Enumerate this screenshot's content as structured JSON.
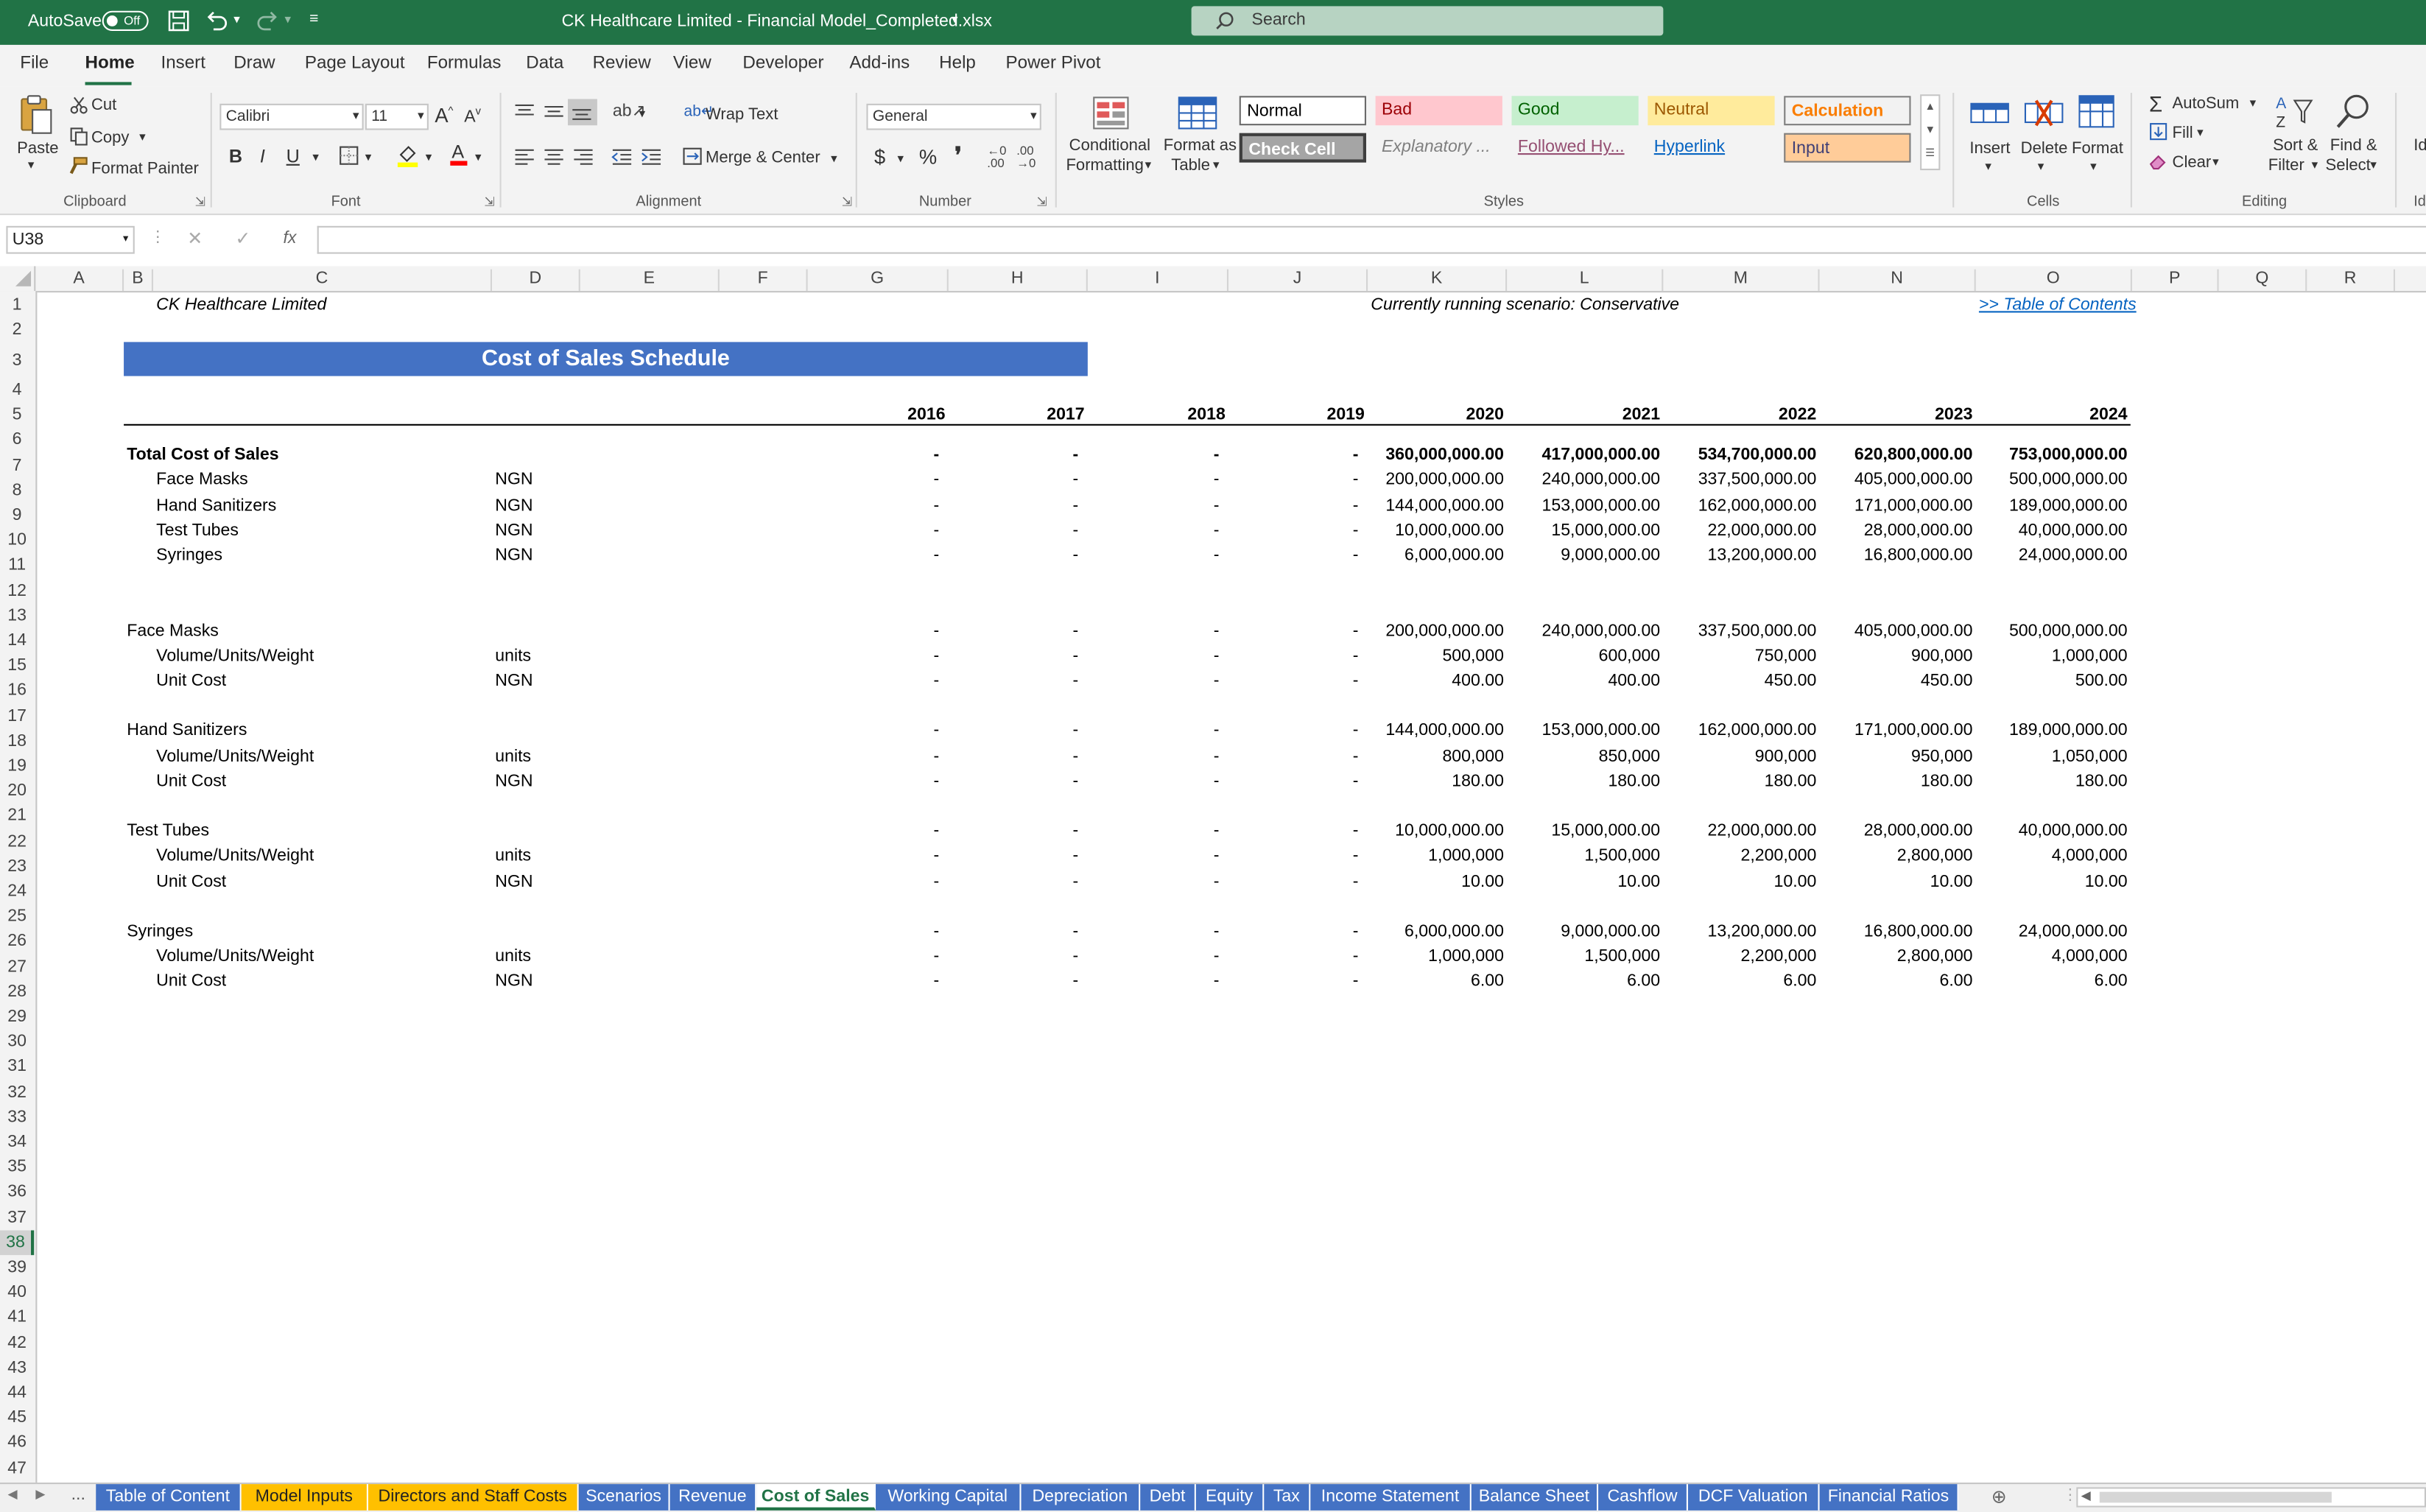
{
  "titlebar": {
    "autosave_label": "AutoSave",
    "autosave_state": "Off",
    "filename": "CK Healthcare Limited - Financial Model_Completed.xlsx",
    "search_placeholder": "Search"
  },
  "menu": [
    "File",
    "Home",
    "Insert",
    "Draw",
    "Page Layout",
    "Formulas",
    "Data",
    "Review",
    "View",
    "Developer",
    "Add-ins",
    "Help",
    "Power Pivot"
  ],
  "ribbon": {
    "clipboard": {
      "paste": "Paste",
      "cut": "Cut",
      "copy": "Copy",
      "format_painter": "Format Painter",
      "group": "Clipboard"
    },
    "font": {
      "name": "Calibri",
      "size": "11",
      "group": "Font",
      "bold": "B",
      "italic": "I",
      "underline": "U"
    },
    "alignment": {
      "wrap_text": "Wrap Text",
      "merge_center": "Merge & Center",
      "group": "Alignment"
    },
    "number": {
      "format": "General",
      "currency": "$",
      "percent": "%",
      "comma": "ஞ",
      "group": "Number"
    },
    "styles": {
      "conditional": "Conditional",
      "formatting": "Formatting",
      "format_as": "Format as",
      "table": "Table",
      "group": "Styles",
      "cells": [
        {
          "label": "Normal"
        },
        {
          "label": "Bad"
        },
        {
          "label": "Good"
        },
        {
          "label": "Neutral"
        },
        {
          "label": "Calculation"
        },
        {
          "label": "Check Cell"
        },
        {
          "label": "Explanatory ..."
        },
        {
          "label": "Followed Hy..."
        },
        {
          "label": "Hyperlink"
        },
        {
          "label": "Input"
        }
      ]
    },
    "cells": {
      "insert": "Insert",
      "delete": "Delete",
      "format": "Format",
      "group": "Cells"
    },
    "editing": {
      "autosum": "AutoSum",
      "fill": "Fill",
      "clear": "Clear",
      "sort": "Sort &",
      "filter": "Filter",
      "find": "Find &",
      "select": "Select",
      "group": "Editing",
      "extra": "Id"
    }
  },
  "formula": {
    "name_box": "U38",
    "fx": "fx",
    "content": ""
  },
  "columns": [
    "A",
    "B",
    "C",
    "D",
    "E",
    "F",
    "G",
    "H",
    "I",
    "J",
    "K",
    "L",
    "M",
    "N",
    "O",
    "P",
    "Q",
    "R"
  ],
  "rows": [
    "1",
    "2",
    "3",
    "4",
    "5",
    "6",
    "7",
    "8",
    "9",
    "10",
    "11",
    "12",
    "13",
    "14",
    "15",
    "16",
    "17",
    "18",
    "19",
    "20",
    "21",
    "22",
    "23",
    "24",
    "25",
    "26",
    "27",
    "28",
    "29",
    "30",
    "31",
    "32",
    "33",
    "34",
    "35",
    "36",
    "37",
    "38",
    "39",
    "40",
    "41",
    "42",
    "43",
    "44",
    "45",
    "46",
    "47"
  ],
  "sheet": {
    "company": "CK Healthcare Limited",
    "scenario": "Currently running scenario: Conservative",
    "toc_link": ">> Table of Contents",
    "title": "Cost of Sales Schedule",
    "years": [
      "2016",
      "2017",
      "2018",
      "2019",
      "2020",
      "2021",
      "2022",
      "2023",
      "2024"
    ],
    "table": [
      {
        "row": 7,
        "label": "Total Cost of Sales",
        "unit": "",
        "bold": true,
        "indent": false,
        "values": [
          "-",
          "-",
          "-",
          "-",
          "360,000,000.00",
          "417,000,000.00",
          "534,700,000.00",
          "620,800,000.00",
          "753,000,000.00"
        ]
      },
      {
        "row": 8,
        "label": "Face Masks",
        "unit": "NGN",
        "bold": false,
        "indent": true,
        "values": [
          "-",
          "-",
          "-",
          "-",
          "200,000,000.00",
          "240,000,000.00",
          "337,500,000.00",
          "405,000,000.00",
          "500,000,000.00"
        ]
      },
      {
        "row": 9,
        "label": "Hand Sanitizers",
        "unit": "NGN",
        "bold": false,
        "indent": true,
        "values": [
          "-",
          "-",
          "-",
          "-",
          "144,000,000.00",
          "153,000,000.00",
          "162,000,000.00",
          "171,000,000.00",
          "189,000,000.00"
        ]
      },
      {
        "row": 10,
        "label": "Test Tubes",
        "unit": "NGN",
        "bold": false,
        "indent": true,
        "values": [
          "-",
          "-",
          "-",
          "-",
          "10,000,000.00",
          "15,000,000.00",
          "22,000,000.00",
          "28,000,000.00",
          "40,000,000.00"
        ]
      },
      {
        "row": 11,
        "label": "Syringes",
        "unit": "NGN",
        "bold": false,
        "indent": true,
        "values": [
          "-",
          "-",
          "-",
          "-",
          "6,000,000.00",
          "9,000,000.00",
          "13,200,000.00",
          "16,800,000.00",
          "24,000,000.00"
        ]
      },
      {
        "row": 14,
        "label": "Face Masks",
        "unit": "",
        "bold": false,
        "indent": false,
        "values": [
          "-",
          "-",
          "-",
          "-",
          "200,000,000.00",
          "240,000,000.00",
          "337,500,000.00",
          "405,000,000.00",
          "500,000,000.00"
        ]
      },
      {
        "row": 15,
        "label": "Volume/Units/Weight",
        "unit": "units",
        "bold": false,
        "indent": true,
        "values": [
          "-",
          "-",
          "-",
          "-",
          "500,000",
          "600,000",
          "750,000",
          "900,000",
          "1,000,000"
        ]
      },
      {
        "row": 16,
        "label": "Unit Cost",
        "unit": "NGN",
        "bold": false,
        "indent": true,
        "values": [
          "-",
          "-",
          "-",
          "-",
          "400.00",
          "400.00",
          "450.00",
          "450.00",
          "500.00"
        ]
      },
      {
        "row": 18,
        "label": "Hand Sanitizers",
        "unit": "",
        "bold": false,
        "indent": false,
        "values": [
          "-",
          "-",
          "-",
          "-",
          "144,000,000.00",
          "153,000,000.00",
          "162,000,000.00",
          "171,000,000.00",
          "189,000,000.00"
        ]
      },
      {
        "row": 19,
        "label": "Volume/Units/Weight",
        "unit": "units",
        "bold": false,
        "indent": true,
        "values": [
          "-",
          "-",
          "-",
          "-",
          "800,000",
          "850,000",
          "900,000",
          "950,000",
          "1,050,000"
        ]
      },
      {
        "row": 20,
        "label": "Unit Cost",
        "unit": "NGN",
        "bold": false,
        "indent": true,
        "values": [
          "-",
          "-",
          "-",
          "-",
          "180.00",
          "180.00",
          "180.00",
          "180.00",
          "180.00"
        ]
      },
      {
        "row": 22,
        "label": "Test Tubes",
        "unit": "",
        "bold": false,
        "indent": false,
        "values": [
          "-",
          "-",
          "-",
          "-",
          "10,000,000.00",
          "15,000,000.00",
          "22,000,000.00",
          "28,000,000.00",
          "40,000,000.00"
        ]
      },
      {
        "row": 23,
        "label": "Volume/Units/Weight",
        "unit": "units",
        "bold": false,
        "indent": true,
        "values": [
          "-",
          "-",
          "-",
          "-",
          "1,000,000",
          "1,500,000",
          "2,200,000",
          "2,800,000",
          "4,000,000"
        ]
      },
      {
        "row": 24,
        "label": "Unit Cost",
        "unit": "NGN",
        "bold": false,
        "indent": true,
        "values": [
          "-",
          "-",
          "-",
          "-",
          "10.00",
          "10.00",
          "10.00",
          "10.00",
          "10.00"
        ]
      },
      {
        "row": 26,
        "label": "Syringes",
        "unit": "",
        "bold": false,
        "indent": false,
        "values": [
          "-",
          "-",
          "-",
          "-",
          "6,000,000.00",
          "9,000,000.00",
          "13,200,000.00",
          "16,800,000.00",
          "24,000,000.00"
        ]
      },
      {
        "row": 27,
        "label": "Volume/Units/Weight",
        "unit": "units",
        "bold": false,
        "indent": true,
        "values": [
          "-",
          "-",
          "-",
          "-",
          "1,000,000",
          "1,500,000",
          "2,200,000",
          "2,800,000",
          "4,000,000"
        ]
      },
      {
        "row": 28,
        "label": "Unit Cost",
        "unit": "NGN",
        "bold": false,
        "indent": true,
        "values": [
          "-",
          "-",
          "-",
          "-",
          "6.00",
          "6.00",
          "6.00",
          "6.00",
          "6.00"
        ]
      }
    ]
  },
  "tabs": [
    {
      "label": "Table of Content",
      "style": "blue"
    },
    {
      "label": "Model Inputs",
      "style": "yellow"
    },
    {
      "label": "Directors and Staff Costs",
      "style": "yellow"
    },
    {
      "label": "Scenarios",
      "style": "blue"
    },
    {
      "label": "Revenue",
      "style": "blue"
    },
    {
      "label": "Cost of Sales",
      "style": "active"
    },
    {
      "label": "Working Capital",
      "style": "blue"
    },
    {
      "label": "Depreciation",
      "style": "blue"
    },
    {
      "label": "Debt",
      "style": "blue"
    },
    {
      "label": "Equity",
      "style": "blue"
    },
    {
      "label": "Tax",
      "style": "blue"
    },
    {
      "label": "Income Statement",
      "style": "blue"
    },
    {
      "label": "Balance Sheet",
      "style": "blue"
    },
    {
      "label": "Cashflow",
      "style": "blue"
    },
    {
      "label": "DCF Valuation",
      "style": "blue"
    },
    {
      "label": "Financial Ratios",
      "style": "blue"
    }
  ],
  "tab_nav_more": "..."
}
